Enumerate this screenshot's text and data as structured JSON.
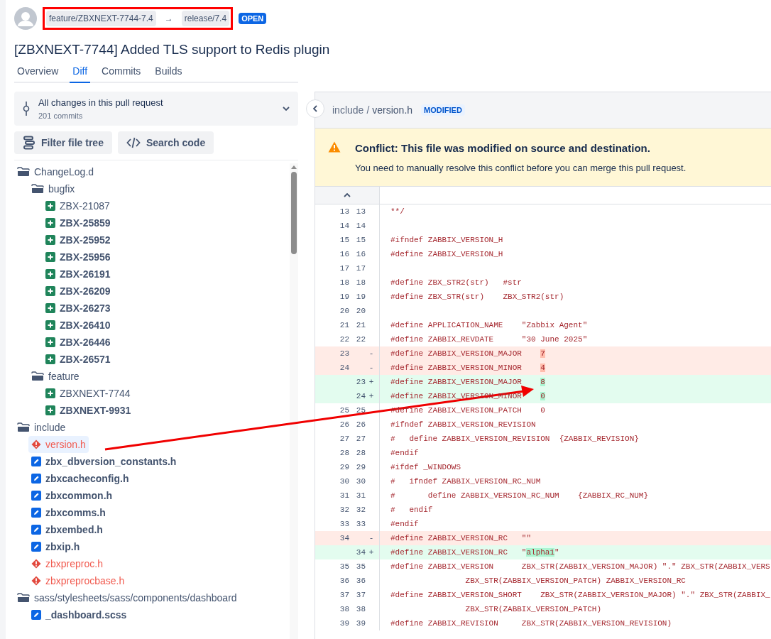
{
  "header": {
    "source_branch": "feature/ZBXNEXT-7744-7.4",
    "arrow": "→",
    "target_branch": "release/7.4",
    "status": "OPEN",
    "title": "[ZBXNEXT-7744] Added TLS support to Redis plugin"
  },
  "tabs": [
    {
      "label": "Overview",
      "selected": false
    },
    {
      "label": "Diff",
      "selected": true
    },
    {
      "label": "Commits",
      "selected": false
    },
    {
      "label": "Builds",
      "selected": false
    }
  ],
  "commit_selector": {
    "title": "All changes in this pull request",
    "subtitle": "201 commits"
  },
  "buttons": [
    {
      "kind": "filter",
      "label": "Filter file tree"
    },
    {
      "kind": "search",
      "label": "Search code"
    }
  ],
  "file_tree": [
    {
      "kind": "folder",
      "name": "ChangeLog.d",
      "children": [
        {
          "kind": "folder",
          "name": "bugfix",
          "children": [
            {
              "kind": "added",
              "name": "ZBX-21087",
              "bold": false,
              "selected": false
            },
            {
              "kind": "added",
              "name": "ZBX-25859",
              "bold": true,
              "selected": false
            },
            {
              "kind": "added",
              "name": "ZBX-25952",
              "bold": true,
              "selected": false
            },
            {
              "kind": "added",
              "name": "ZBX-25956",
              "bold": true,
              "selected": false
            },
            {
              "kind": "added",
              "name": "ZBX-26191",
              "bold": true,
              "selected": false
            },
            {
              "kind": "added",
              "name": "ZBX-26209",
              "bold": true,
              "selected": false
            },
            {
              "kind": "added",
              "name": "ZBX-26273",
              "bold": true,
              "selected": false
            },
            {
              "kind": "added",
              "name": "ZBX-26410",
              "bold": true,
              "selected": false
            },
            {
              "kind": "added",
              "name": "ZBX-26446",
              "bold": true,
              "selected": false
            },
            {
              "kind": "added",
              "name": "ZBX-26571",
              "bold": true,
              "selected": false
            }
          ]
        },
        {
          "kind": "folder",
          "name": "feature",
          "children": [
            {
              "kind": "added",
              "name": "ZBXNEXT-7744",
              "bold": false,
              "selected": false
            },
            {
              "kind": "added",
              "name": "ZBXNEXT-9931",
              "bold": true,
              "selected": false
            }
          ]
        }
      ]
    },
    {
      "kind": "folder",
      "name": "include",
      "children": [
        {
          "kind": "conflict",
          "name": "version.h",
          "bold": false,
          "selected": true
        },
        {
          "kind": "modified",
          "name": "zbx_dbversion_constants.h",
          "bold": true,
          "selected": false
        },
        {
          "kind": "modified",
          "name": "zbxcacheconfig.h",
          "bold": true,
          "selected": false
        },
        {
          "kind": "modified",
          "name": "zbxcommon.h",
          "bold": true,
          "selected": false
        },
        {
          "kind": "modified",
          "name": "zbxcomms.h",
          "bold": true,
          "selected": false
        },
        {
          "kind": "modified",
          "name": "zbxembed.h",
          "bold": true,
          "selected": false
        },
        {
          "kind": "modified",
          "name": "zbxip.h",
          "bold": true,
          "selected": false
        },
        {
          "kind": "conflict",
          "name": "zbxpreproc.h",
          "bold": false,
          "selected": false
        },
        {
          "kind": "conflict",
          "name": "zbxpreprocbase.h",
          "bold": false,
          "selected": false
        }
      ]
    },
    {
      "kind": "folder",
      "name": "sass/stylesheets/sass/components/dashboard",
      "children": [
        {
          "kind": "modified",
          "name": "_dashboard.scss",
          "bold": true,
          "selected": false
        }
      ]
    }
  ],
  "file_header": {
    "folder": "include",
    "separator": "/",
    "file": "version.h",
    "badge": "MODIFIED"
  },
  "conflict": {
    "title": "Conflict: This file was modified on source and destination.",
    "message": "You need to manually resolve this conflict before you can merge this pull request."
  },
  "diff_lines": [
    {
      "kind": "context",
      "old": "13",
      "new": "13",
      "parts": [
        "**/"
      ]
    },
    {
      "kind": "context",
      "old": "14",
      "new": "14"
    },
    {
      "kind": "context",
      "old": "15",
      "new": "15",
      "parts": [
        "#ifndef ZABBIX_VERSION_H"
      ]
    },
    {
      "kind": "context",
      "old": "16",
      "new": "16",
      "parts": [
        "#define ZABBIX_VERSION_H"
      ]
    },
    {
      "kind": "context",
      "old": "17",
      "new": "17"
    },
    {
      "kind": "context",
      "old": "18",
      "new": "18",
      "parts": [
        "#define ZBX_STR2(str)   #str"
      ]
    },
    {
      "kind": "context",
      "old": "19",
      "new": "19",
      "parts": [
        "#define ZBX_STR(str)    ZBX_STR2(str)"
      ]
    },
    {
      "kind": "context",
      "old": "20",
      "new": "20"
    },
    {
      "kind": "context",
      "old": "21",
      "new": "21",
      "parts": [
        "#define APPLICATION_NAME    \"Zabbix Agent\""
      ]
    },
    {
      "kind": "context",
      "old": "22",
      "new": "22",
      "parts": [
        "#define ZABBIX_REVDATE      \"30 June 2025\""
      ]
    },
    {
      "kind": "removed",
      "old": "23",
      "marker": "-",
      "parts": [
        "#define ZABBIX_VERSION_MAJOR    ",
        "7"
      ]
    },
    {
      "kind": "removed",
      "old": "24",
      "marker": "-",
      "parts": [
        "#define ZABBIX_VERSION_MINOR    ",
        "4"
      ]
    },
    {
      "kind": "added",
      "new": "23",
      "marker": "+",
      "parts": [
        "#define ZABBIX_VERSION_MAJOR    ",
        "8"
      ]
    },
    {
      "kind": "added",
      "new": "24",
      "marker": "+",
      "parts": [
        "#define ZABBIX_VERSION_MINOR    ",
        "0"
      ]
    },
    {
      "kind": "context",
      "old": "25",
      "new": "25",
      "parts": [
        "#define ZABBIX_VERSION_PATCH    0"
      ]
    },
    {
      "kind": "context",
      "old": "26",
      "new": "26",
      "parts": [
        "#ifndef ZABBIX_VERSION_REVISION"
      ]
    },
    {
      "kind": "context",
      "old": "27",
      "new": "27",
      "parts": [
        "#   define ZABBIX_VERSION_REVISION  {ZABBIX_REVISION}"
      ]
    },
    {
      "kind": "context",
      "old": "28",
      "new": "28",
      "parts": [
        "#endif"
      ]
    },
    {
      "kind": "context",
      "old": "29",
      "new": "29",
      "parts": [
        "#ifdef _WINDOWS"
      ]
    },
    {
      "kind": "context",
      "old": "30",
      "new": "30",
      "parts": [
        "#   ifndef ZABBIX_VERSION_RC_NUM"
      ]
    },
    {
      "kind": "context",
      "old": "31",
      "new": "31",
      "parts": [
        "#       define ZABBIX_VERSION_RC_NUM    {ZABBIX_RC_NUM}"
      ]
    },
    {
      "kind": "context",
      "old": "32",
      "new": "32",
      "parts": [
        "#   endif"
      ]
    },
    {
      "kind": "context",
      "old": "33",
      "new": "33",
      "parts": [
        "#endif"
      ]
    },
    {
      "kind": "removed",
      "old": "34",
      "marker": "-",
      "parts": [
        "#define ZABBIX_VERSION_RC   \"\""
      ]
    },
    {
      "kind": "added",
      "new": "34",
      "marker": "+",
      "parts": [
        "#define ZABBIX_VERSION_RC   \"",
        "alpha1",
        "\""
      ]
    },
    {
      "kind": "context",
      "old": "35",
      "new": "35",
      "parts": [
        "#define ZABBIX_VERSION      ZBX_STR(ZABBIX_VERSION_MAJOR) \".\" ZBX_STR(ZABBIX_VERS"
      ]
    },
    {
      "kind": "context",
      "old": "36",
      "new": "36",
      "parts": [
        "                ZBX_STR(ZABBIX_VERSION_PATCH) ZABBIX_VERSION_RC"
      ]
    },
    {
      "kind": "context",
      "old": "37",
      "new": "37",
      "parts": [
        "#define ZABBIX_VERSION_SHORT    ZBX_STR(ZABBIX_VERSION_MAJOR) \".\" ZBX_STR(ZABBIX_"
      ]
    },
    {
      "kind": "context",
      "old": "38",
      "new": "38",
      "parts": [
        "                ZBX_STR(ZABBIX_VERSION_PATCH)"
      ]
    },
    {
      "kind": "context",
      "old": "39",
      "new": "39",
      "parts": [
        "#define ZABBIX_REVISION     ZBX_STR(ZABBIX_VERSION_REVISION)"
      ]
    }
  ]
}
